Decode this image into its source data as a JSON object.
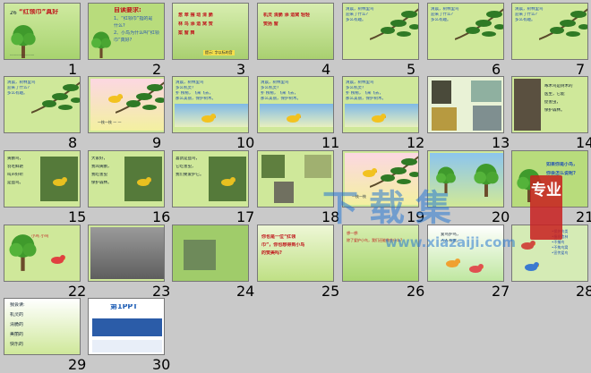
{
  "slides": [
    {
      "num": "1",
      "kind": "title",
      "title_prefix": "26",
      "title_main": "“红领巾”真好",
      "footer": "-------------------------"
    },
    {
      "num": "2",
      "kind": "questions",
      "heading": "自读要求:",
      "lines": [
        "1、“红领巾”指的是",
        "什么?",
        "2、小鸟为什么叫“红领",
        "巾”真好?"
      ]
    },
    {
      "num": "3",
      "kind": "wordcards",
      "lines": [
        "葱 翠 摆 动 清 脆",
        "林 鸟 添 造 窝 赞",
        "案 窗 舞"
      ],
      "note": "提示: 字以标的音"
    },
    {
      "num": "4",
      "kind": "wordcards",
      "lines": [
        "机灵 清脆 添 造窝 轻轻",
        "赞扬 窗"
      ]
    },
    {
      "num": "5",
      "kind": "poem",
      "lines": [
        "清晨，树林里鸟",
        "迎来了什么?",
        "多么有趣。"
      ]
    },
    {
      "num": "6",
      "kind": "poem",
      "lines": [
        "清晨，树林里鸟",
        "迎来了什么?",
        "多么有趣。"
      ]
    },
    {
      "num": "7",
      "kind": "poem",
      "lines": [
        "清晨，树林里鸟",
        "迎来了什么?",
        "多么有趣。"
      ]
    },
    {
      "num": "8",
      "kind": "poem",
      "lines": [
        "清晨，树林里鸟",
        "迎来了什么?",
        "多么有趣。"
      ]
    },
    {
      "num": "9",
      "kind": "illustration",
      "lines": [
        "一枝一枝  一  一"
      ]
    },
    {
      "num": "10",
      "kind": "poem2",
      "lines": [
        "清晨，树林里鸟",
        "多么机灵?",
        "扑 楞楞，飞来飞去，",
        "那么美丽，保护树木。"
      ]
    },
    {
      "num": "11",
      "kind": "poem2",
      "lines": [
        "清晨，树林里鸟",
        "多么机灵?",
        "扑 楞楞，飞来飞去，",
        "那么美丽，保护树木。"
      ]
    },
    {
      "num": "12",
      "kind": "poem2",
      "lines": [
        "清晨，树林里鸟",
        "多么机灵?",
        "扑 楞楞，飞来飞去，",
        "那么美丽，保护树木。"
      ]
    },
    {
      "num": "13",
      "kind": "birds",
      "lines": []
    },
    {
      "num": "14",
      "kind": "text",
      "lines": [
        "啄木鸟是树木的",
        "医生，它能",
        "捉害虫，",
        "保护森林。"
      ]
    },
    {
      "num": "15",
      "kind": "textbird",
      "lines": [
        "黄鹂鸟，",
        "羽毛鲜艳",
        "叫声好听",
        "是益鸟。"
      ]
    },
    {
      "num": "16",
      "kind": "textbird",
      "lines": [
        "大家好，",
        "我叫黄鹂，",
        "我吃害虫",
        "保护森林。"
      ]
    },
    {
      "num": "17",
      "kind": "textbird",
      "lines": [
        "喜鹊是益鸟，",
        "它吃害虫，",
        "我们要爱护它。"
      ]
    },
    {
      "num": "18",
      "kind": "photos",
      "lines": []
    },
    {
      "num": "19",
      "kind": "illustration",
      "lines": [
        "一枝一枝"
      ]
    },
    {
      "num": "20",
      "kind": "scene",
      "lines": []
    },
    {
      "num": "21",
      "kind": "question",
      "lines": [
        "如果你是小鸟，",
        "你会怎么说呢?"
      ]
    },
    {
      "num": "22",
      "kind": "cartoon",
      "lines": [
        "小鸟 小鸟"
      ]
    },
    {
      "num": "23",
      "kind": "photo",
      "lines": []
    },
    {
      "num": "24",
      "kind": "photo2",
      "lines": []
    },
    {
      "num": "25",
      "kind": "redtext",
      "lines": [
        "你也是一位“红领",
        "巾”，你也想得到小鸟",
        "的赞美吗?"
      ]
    },
    {
      "num": "26",
      "kind": "plain",
      "lines": [
        "想一想:",
        "除了爱护小鸟，我们还能做些什么?"
      ]
    },
    {
      "num": "27",
      "kind": "cartoon2",
      "lines": [
        "爱鸟护鸟，",
        "人人有责。"
      ]
    },
    {
      "num": "28",
      "kind": "list",
      "lines": [
        "•保护鸟类",
        "•植树造林",
        "•不捕鸟",
        "•不掏鸟窝",
        "•宣传爱鸟"
      ]
    },
    {
      "num": "29",
      "kind": "summary",
      "lines": [
        "我会读:",
        "机灵的",
        "清脆的",
        "美丽的",
        "快乐的"
      ]
    },
    {
      "num": "30",
      "kind": "brand",
      "brand": "第1PPT",
      "lines": []
    }
  ],
  "watermark": {
    "text": "下载集",
    "badge": "专业",
    "url": "www.xiazaiji.com"
  },
  "colors": {
    "slide_bg": "#cfe89a",
    "bg": "#c9c9c9",
    "accent_blue": "#2554b3",
    "accent_red": "#c0161c"
  }
}
